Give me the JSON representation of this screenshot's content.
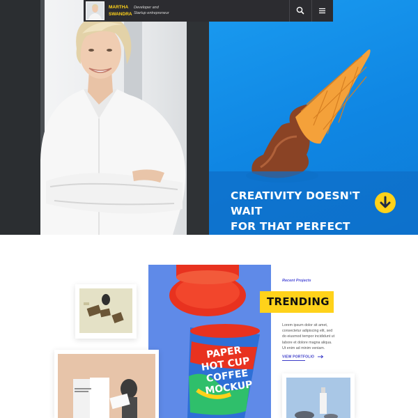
{
  "header": {
    "brand_line1": "MARTHA",
    "brand_line2": "SWANDRA",
    "tagline_line1": "Developer and",
    "tagline_line2": "Startup entrepreneur",
    "search_icon": "search-icon",
    "menu_icon": "hamburger-menu-icon"
  },
  "hero": {
    "headline_line1": "CREATIVITY DOESN'T WAIT",
    "headline_line2": "FOR THAT PERFECT MOMENT",
    "arrow_icon": "arrow-down-circle-icon"
  },
  "portfolio": {
    "label": "Recent Projects",
    "title": "TRENDING",
    "description_lines": [
      "Lorem ipsum dolor sit amet,",
      "consectetur adipiscing elit, sed",
      "do eiusmod tempor incididunt ut",
      "labore et dolore magna aliqua.",
      "Ut enim ad minim veniam."
    ],
    "link": "VIEW PORTFOLIO",
    "cup_text": [
      "PAPER",
      "HOT CUP",
      "COFFEE",
      "MOCKUP"
    ]
  },
  "colors": {
    "accent_yellow": "#ffd21a",
    "hero_blue": "#1a9bf0",
    "topbar_dark": "#2c2c30",
    "link_blue": "#3c3cc8",
    "cup_panel_blue": "#5f8ae8"
  }
}
